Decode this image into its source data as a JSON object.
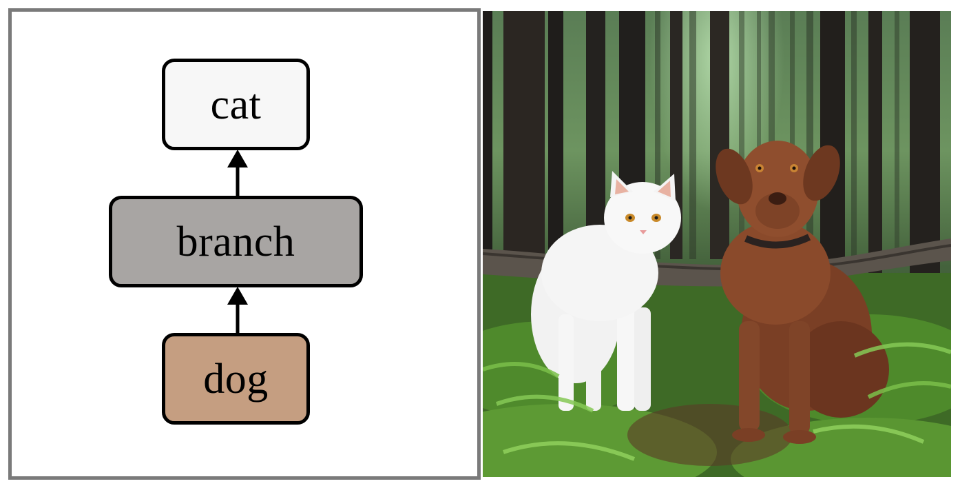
{
  "diagram": {
    "nodes": {
      "top": {
        "label": "cat",
        "fill": "#f7f7f7"
      },
      "middle": {
        "label": "branch",
        "fill": "#a8a5a3"
      },
      "bottom": {
        "label": "dog",
        "fill": "#c59e81"
      }
    },
    "edges": [
      {
        "from": "dog",
        "to": "branch"
      },
      {
        "from": "branch",
        "to": "cat"
      }
    ],
    "frame_color": "#7a7a7a"
  },
  "photo": {
    "subject": "white-cat-and-brown-dog-under-branch-in-forest"
  }
}
